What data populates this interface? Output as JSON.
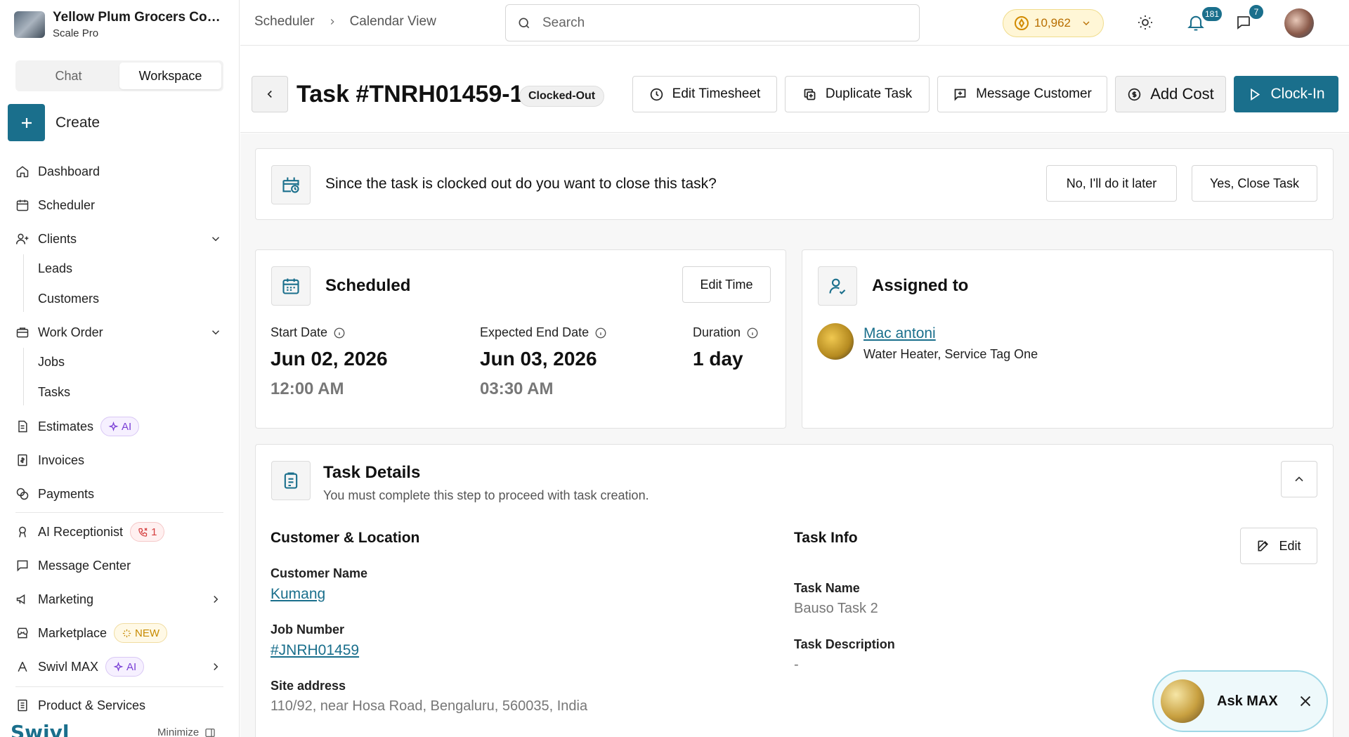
{
  "org": {
    "name": "Yellow Plum Grocers Com...",
    "plan": "Scale Pro"
  },
  "sidebar": {
    "tabs": [
      "Chat",
      "Workspace"
    ],
    "create_label": "Create",
    "items": {
      "dashboard": "Dashboard",
      "scheduler": "Scheduler",
      "clients": "Clients",
      "leads": "Leads",
      "customers": "Customers",
      "work_order": "Work Order",
      "jobs": "Jobs",
      "tasks": "Tasks",
      "estimates": "Estimates",
      "invoices": "Invoices",
      "payments": "Payments",
      "ai_receptionist": "AI Receptionist",
      "message_center": "Message Center",
      "marketing": "Marketing",
      "marketplace": "Marketplace",
      "swivl_max": "Swivl MAX",
      "product_services": "Product & Services"
    },
    "badges": {
      "ai": "AI",
      "calls": "1",
      "new": "NEW"
    },
    "brand": "Swivl",
    "minimize": "Minimize"
  },
  "topbar": {
    "breadcrumbs": [
      "Scheduler",
      "Calendar View"
    ],
    "search_placeholder": "Search",
    "coins": "10,962",
    "notifications": "181",
    "messages": "7"
  },
  "header": {
    "title": "Task #TNRH01459-1",
    "status": "Clocked-Out",
    "buttons": {
      "edit_timesheet": "Edit Timesheet",
      "duplicate_task": "Duplicate Task",
      "message_customer": "Message Customer",
      "add_cost": "Add Cost",
      "clock_in": "Clock-In"
    }
  },
  "banner": {
    "text": "Since the task is clocked out do you want to close this task?",
    "no_label": "No, I'll do it later",
    "yes_label": "Yes, Close Task"
  },
  "scheduled": {
    "title": "Scheduled",
    "edit_label": "Edit Time",
    "start_label": "Start Date",
    "start_date": "Jun 02, 2026",
    "start_time": "12:00 AM",
    "end_label": "Expected End Date",
    "end_date": "Jun 03, 2026",
    "end_time": "03:30 AM",
    "duration_label": "Duration",
    "duration": "1 day"
  },
  "assigned": {
    "title": "Assigned to",
    "name": "Mac antoni",
    "tags": "Water Heater, Service Tag One"
  },
  "task_details": {
    "title": "Task Details",
    "subtitle": "You must complete this step to proceed with task creation.",
    "customer_section": "Customer & Location",
    "customer_name_label": "Customer Name",
    "customer_name": "Kumang",
    "job_number_label": "Job Number",
    "job_number": "#JNRH01459",
    "site_address_label": "Site address",
    "site_address": "110/92, near Hosa Road, Bengaluru, 560035, India",
    "task_info_section": "Task Info",
    "edit_label": "Edit",
    "task_name_label": "Task Name",
    "task_name": "Bauso Task 2",
    "task_desc_label": "Task Description",
    "task_desc": "-"
  },
  "askmax": {
    "label": "Ask MAX"
  },
  "colors": {
    "primary": "#1a6f8c",
    "ai": "#7a3fd6",
    "warn": "#d43d3d",
    "coin": "#b86e00"
  }
}
